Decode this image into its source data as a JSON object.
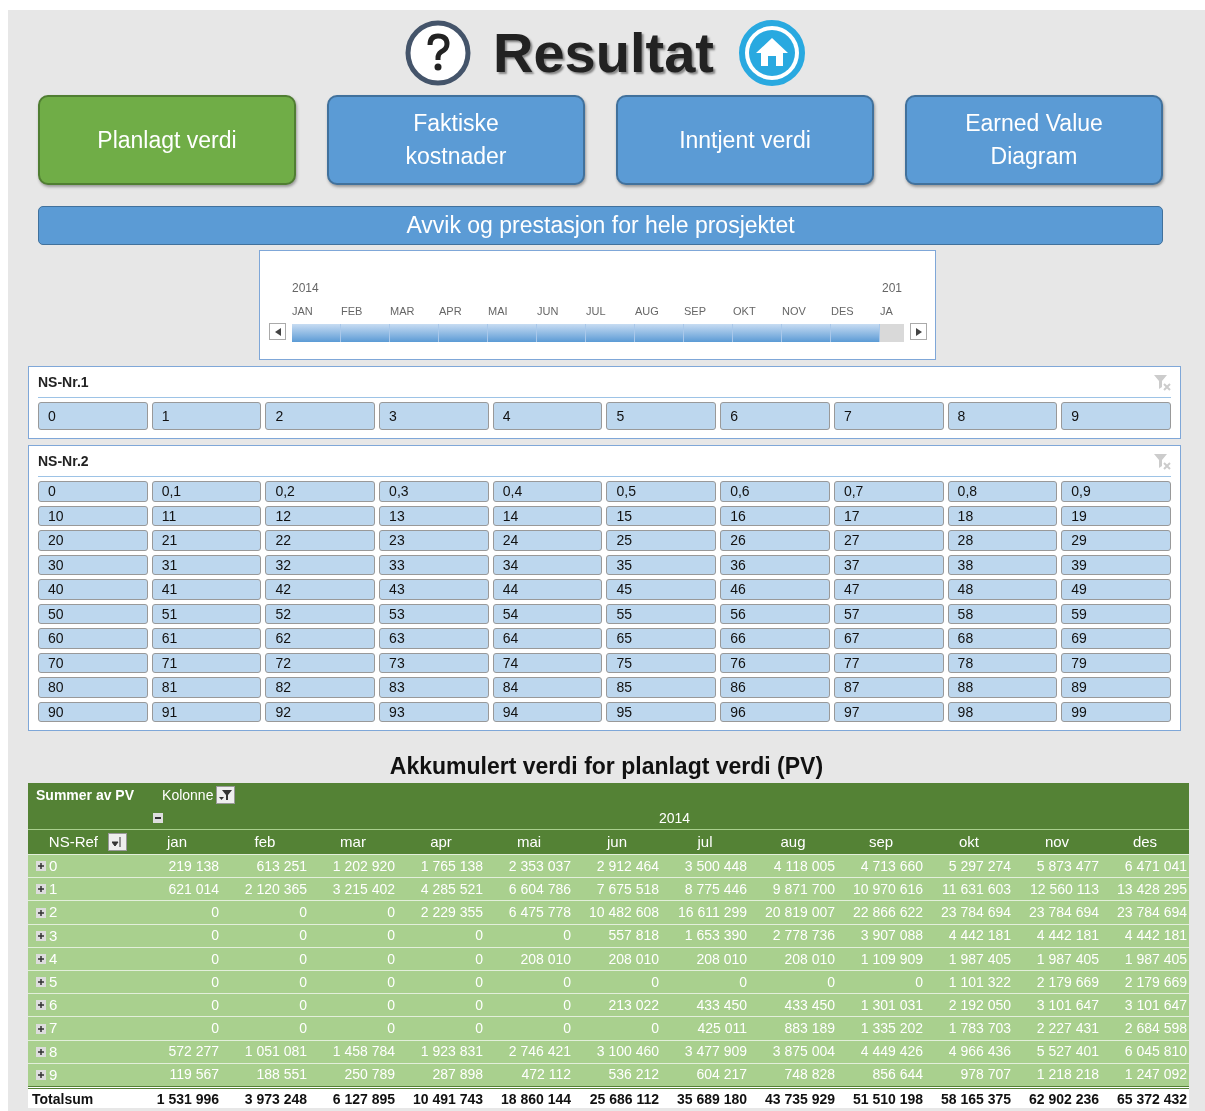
{
  "title": "Resultat",
  "nav_buttons": [
    {
      "label": "Planlagt verdi",
      "selected": true
    },
    {
      "label": "Faktiske kostnader",
      "selected": false
    },
    {
      "label": "Inntjent verdi",
      "selected": false
    },
    {
      "label": "Earned Value Diagram",
      "selected": false
    }
  ],
  "banner": "Avvik og prestasjon for hele prosjektet",
  "timeline": {
    "year": "2014",
    "next_year": "201",
    "months": [
      {
        "label": "JAN",
        "selected": true
      },
      {
        "label": "FEB",
        "selected": true
      },
      {
        "label": "MAR",
        "selected": true
      },
      {
        "label": "APR",
        "selected": true
      },
      {
        "label": "MAI",
        "selected": true
      },
      {
        "label": "JUN",
        "selected": true
      },
      {
        "label": "JUL",
        "selected": true
      },
      {
        "label": "AUG",
        "selected": true
      },
      {
        "label": "SEP",
        "selected": true
      },
      {
        "label": "OKT",
        "selected": true
      },
      {
        "label": "NOV",
        "selected": true
      },
      {
        "label": "DES",
        "selected": true
      },
      {
        "label": "JA",
        "selected": false
      }
    ]
  },
  "slicers": [
    {
      "title": "NS-Nr.1",
      "items": [
        "0",
        "1",
        "2",
        "3",
        "4",
        "5",
        "6",
        "7",
        "8",
        "9"
      ]
    },
    {
      "title": "NS-Nr.2",
      "items": [
        "0",
        "0,1",
        "0,2",
        "0,3",
        "0,4",
        "0,5",
        "0,6",
        "0,7",
        "0,8",
        "0,9",
        "10",
        "11",
        "12",
        "13",
        "14",
        "15",
        "16",
        "17",
        "18",
        "19",
        "20",
        "21",
        "22",
        "23",
        "24",
        "25",
        "26",
        "27",
        "28",
        "29",
        "30",
        "31",
        "32",
        "33",
        "34",
        "35",
        "36",
        "37",
        "38",
        "39",
        "40",
        "41",
        "42",
        "43",
        "44",
        "45",
        "46",
        "47",
        "48",
        "49",
        "50",
        "51",
        "52",
        "53",
        "54",
        "55",
        "56",
        "57",
        "58",
        "59",
        "60",
        "61",
        "62",
        "63",
        "64",
        "65",
        "66",
        "67",
        "68",
        "69",
        "70",
        "71",
        "72",
        "73",
        "74",
        "75",
        "76",
        "77",
        "78",
        "79",
        "80",
        "81",
        "82",
        "83",
        "84",
        "85",
        "86",
        "87",
        "88",
        "89",
        "90",
        "91",
        "92",
        "93",
        "94",
        "95",
        "96",
        "97",
        "98",
        "99"
      ]
    }
  ],
  "pivot": {
    "title": "Akkumulert verdi for planlagt verdi (PV)",
    "measure": "Summer av PV",
    "column_field": "Kolonne",
    "year": "2014",
    "row_field": "NS-Ref",
    "columns": [
      "jan",
      "feb",
      "mar",
      "apr",
      "mai",
      "jun",
      "jul",
      "aug",
      "sep",
      "okt",
      "nov",
      "des"
    ],
    "rows": [
      {
        "label": "0",
        "values": [
          "219 138",
          "613 251",
          "1 202 920",
          "1 765 138",
          "2 353 037",
          "2 912 464",
          "3 500 448",
          "4 118 005",
          "4 713 660",
          "5 297 274",
          "5 873 477",
          "6 471 041"
        ]
      },
      {
        "label": "1",
        "values": [
          "621 014",
          "2 120 365",
          "3 215 402",
          "4 285 521",
          "6 604 786",
          "7 675 518",
          "8 775 446",
          "9 871 700",
          "10 970 616",
          "11 631 603",
          "12 560 113",
          "13 428 295"
        ]
      },
      {
        "label": "2",
        "values": [
          "0",
          "0",
          "0",
          "2 229 355",
          "6 475 778",
          "10 482 608",
          "16 611 299",
          "20 819 007",
          "22 866 622",
          "23 784 694",
          "23 784 694",
          "23 784 694"
        ]
      },
      {
        "label": "3",
        "values": [
          "0",
          "0",
          "0",
          "0",
          "0",
          "557 818",
          "1 653 390",
          "2 778 736",
          "3 907 088",
          "4 442 181",
          "4 442 181",
          "4 442 181"
        ]
      },
      {
        "label": "4",
        "values": [
          "0",
          "0",
          "0",
          "0",
          "208 010",
          "208 010",
          "208 010",
          "208 010",
          "1 109 909",
          "1 987 405",
          "1 987 405",
          "1 987 405"
        ]
      },
      {
        "label": "5",
        "values": [
          "0",
          "0",
          "0",
          "0",
          "0",
          "0",
          "0",
          "0",
          "0",
          "1 101 322",
          "2 179 669",
          "2 179 669"
        ]
      },
      {
        "label": "6",
        "values": [
          "0",
          "0",
          "0",
          "0",
          "0",
          "213 022",
          "433 450",
          "433 450",
          "1 301 031",
          "2 192 050",
          "3 101 647",
          "3 101 647"
        ]
      },
      {
        "label": "7",
        "values": [
          "0",
          "0",
          "0",
          "0",
          "0",
          "0",
          "425 011",
          "883 189",
          "1 335 202",
          "1 783 703",
          "2 227 431",
          "2 684 598"
        ]
      },
      {
        "label": "8",
        "values": [
          "572 277",
          "1 051 081",
          "1 458 784",
          "1 923 831",
          "2 746 421",
          "3 100 460",
          "3 477 909",
          "3 875 004",
          "4 449 426",
          "4 966 436",
          "5 527 401",
          "6 045 810"
        ]
      },
      {
        "label": "9",
        "values": [
          "119 567",
          "188 551",
          "250 789",
          "287 898",
          "472 112",
          "536 212",
          "604 217",
          "748 828",
          "856 644",
          "978 707",
          "1 218 218",
          "1 247 092"
        ]
      }
    ],
    "total": {
      "label": "Totalsum",
      "values": [
        "1 531 996",
        "3 973 248",
        "6 127 895",
        "10 491 743",
        "18 860 144",
        "25 686 112",
        "35 689 180",
        "43 735 929",
        "51 510 198",
        "58 165 375",
        "62 902 236",
        "65 372 432"
      ]
    }
  }
}
